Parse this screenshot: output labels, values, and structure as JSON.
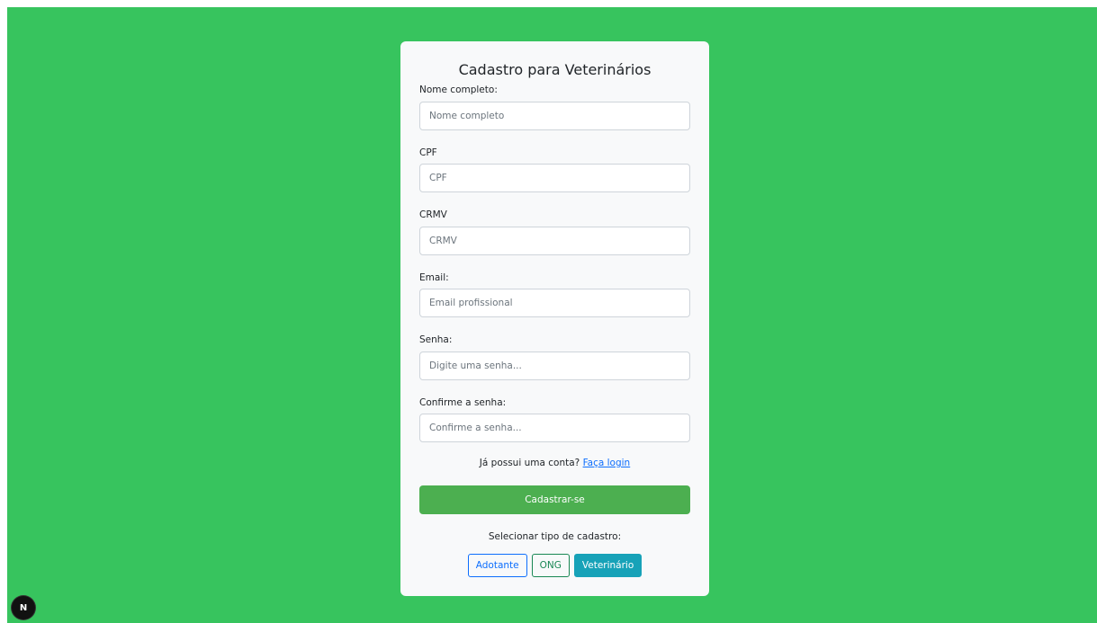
{
  "form": {
    "title": "Cadastro para Veterinários",
    "fields": [
      {
        "label": "Nome completo:",
        "placeholder": "Nome completo",
        "value": ""
      },
      {
        "label": "CPF",
        "placeholder": "CPF",
        "value": ""
      },
      {
        "label": "CRMV",
        "placeholder": "CRMV",
        "value": ""
      },
      {
        "label": "Email:",
        "placeholder": "Email profissional",
        "value": ""
      },
      {
        "label": "Senha:",
        "placeholder": "Digite uma senha...",
        "value": ""
      },
      {
        "label": "Confirme a senha:",
        "placeholder": "Confirme a senha...",
        "value": ""
      }
    ],
    "login_prompt": "Já possui uma conta?",
    "login_link": "Faça login",
    "submit_label": "Cadastrar-se",
    "select_type_label": "Selecionar tipo de cadastro:",
    "type_buttons": [
      {
        "label": "Adotante",
        "selected": false
      },
      {
        "label": "ONG",
        "selected": false
      },
      {
        "label": "Veterinário",
        "selected": true
      }
    ]
  },
  "dev_indicator": {
    "label": "N",
    "icon": "nextjs-logo-icon"
  },
  "colors": {
    "background": "#37c45e",
    "card": "#f8f9fa",
    "submit": "#4caf50",
    "selected_type": "#17a2b8",
    "link": "#0d6efd"
  }
}
